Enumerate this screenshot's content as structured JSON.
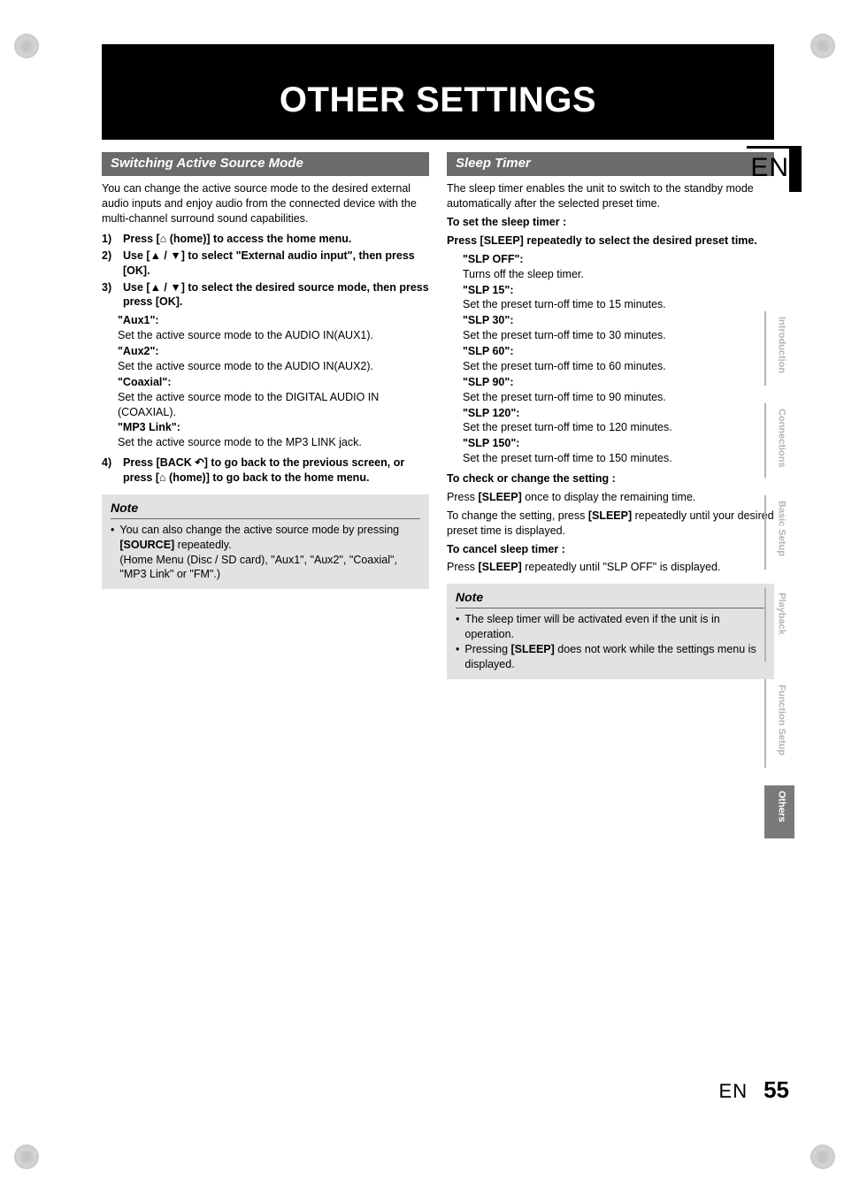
{
  "header": {
    "title": "OTHER SETTINGS"
  },
  "lang_mark": "EN",
  "footer": {
    "lang": "EN",
    "page": "55"
  },
  "tabs": {
    "t1": "Introduction",
    "t2": "Connections",
    "t3": "Basic Setup",
    "t4": "Playback",
    "t5": "Function Setup",
    "t6": "Others"
  },
  "left": {
    "section_title": "Switching Active Source Mode",
    "intro": "You can change the active source mode to the desired external audio inputs and enjoy audio from the connected device with the multi-channel surround sound capabilities.",
    "s1_num": "1)",
    "s1_a": "Press [",
    "s1_home": "⌂",
    "s1_b": " (home)] to access the home menu.",
    "s2_num": "2)",
    "s2_a": "Use [",
    "s2_arrow": "▲ / ▼",
    "s2_b": "] to select \"External audio input\", then press [OK].",
    "s3_num": "3)",
    "s3_a": "Use [",
    "s3_arrow": "▲ / ▼",
    "s3_b": "] to select the desired source mode, then press press [OK].",
    "aux1_lbl": "\"Aux1\":",
    "aux1_desc": "Set the active source mode to the AUDIO IN(AUX1).",
    "aux2_lbl": "\"Aux2\":",
    "aux2_desc": "Set the active source mode to the AUDIO IN(AUX2).",
    "coax_lbl": "\"Coaxial\":",
    "coax_desc": "Set the active source mode to the DIGITAL AUDIO IN (COAXIAL).",
    "mp3_lbl": "\"MP3 Link\":",
    "mp3_desc": "Set the active source mode to the MP3 LINK jack.",
    "s4_num": "4)",
    "s4_a": "Press [BACK ",
    "s4_back": "↶",
    "s4_b": "] to go back to the previous screen, or press [",
    "s4_home": "⌂",
    "s4_c": " (home)] to go back to the home menu.",
    "note_title": "Note",
    "note1_a": "You can also change the active source mode by pressing ",
    "note1_src": "[SOURCE]",
    "note1_b": " repeatedly.",
    "note1_c": "(Home Menu (Disc / SD card), \"Aux1\", \"Aux2\", \"Coaxial\", \"MP3 Link\" or \"FM\".)"
  },
  "right": {
    "section_title": "Sleep Timer",
    "intro": "The sleep timer enables the unit to switch to the standby mode automatically after the selected preset time.",
    "set_hdr": "To set the sleep timer :",
    "set_instr": "Press [SLEEP] repeatedly to select the desired preset time.",
    "opt_off_lbl": "\"SLP OFF\":",
    "opt_off_desc": "Turns off the sleep timer.",
    "opt_15_lbl": "\"SLP 15\":",
    "opt_15_desc": "Set the preset turn-off time to 15 minutes.",
    "opt_30_lbl": "\"SLP 30\":",
    "opt_30_desc": "Set the preset turn-off time to 30 minutes.",
    "opt_60_lbl": "\"SLP 60\":",
    "opt_60_desc": "Set the preset turn-off time to 60 minutes.",
    "opt_90_lbl": "\"SLP 90\":",
    "opt_90_desc": "Set the preset turn-off time to 90 minutes.",
    "opt_120_lbl": "\"SLP 120\":",
    "opt_120_desc": "Set the preset turn-off time to 120 minutes.",
    "opt_150_lbl": "\"SLP 150\":",
    "opt_150_desc": "Set the preset turn-off time to 150 minutes.",
    "check_hdr": "To check or change the setting :",
    "check_l1_a": "Press ",
    "check_l1_b": "[SLEEP]",
    "check_l1_c": " once to display the remaining time.",
    "check_l2_a": "To change the setting, press ",
    "check_l2_b": "[SLEEP]",
    "check_l2_c": " repeatedly until your desired preset time is displayed.",
    "cancel_hdr": "To cancel sleep timer :",
    "cancel_a": "Press ",
    "cancel_b": "[SLEEP]",
    "cancel_c": " repeatedly until \"SLP OFF\" is displayed.",
    "note_title": "Note",
    "note1": "The sleep timer will be activated even if the unit is in operation.",
    "note2_a": "Pressing ",
    "note2_b": "[SLEEP]",
    "note2_c": " does not work while the settings menu is displayed."
  }
}
